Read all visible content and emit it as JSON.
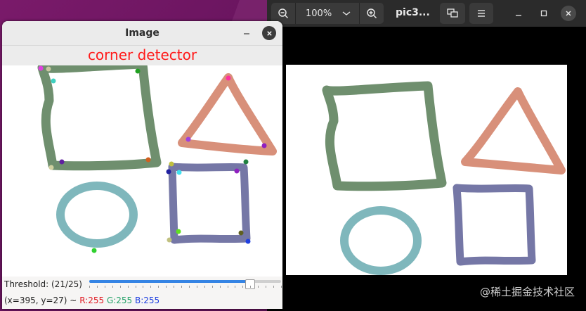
{
  "viewer": {
    "zoom_level": "100%",
    "title": "pic3...",
    "watermark": "@稀土掘金技术社区"
  },
  "cv_window": {
    "title": "Image",
    "banner_text": "corner detector",
    "trackbar": {
      "label": "Threshold:",
      "value_text": "(21/25)",
      "value": 21,
      "max": 25
    },
    "status": {
      "coords": "(x=395, y=27) ~",
      "r": "R:255",
      "g": "G:255",
      "b": "B:255"
    }
  },
  "colors": {
    "square": "#6f8f6e",
    "triangle": "#d8907a",
    "circle": "#7fb7bc",
    "rect": "#7577a6",
    "banner_red": "#ff1a1a",
    "accent": "#3584e4"
  },
  "icons": {
    "zoom_out": "zoom-out-icon",
    "zoom_in": "zoom-in-icon",
    "dropdown": "chevron-down-icon",
    "overlay": "overlay-icon",
    "menu": "hamburger-menu-icon",
    "minimize": "minimize-icon",
    "maximize": "maximize-icon",
    "close": "close-icon"
  }
}
